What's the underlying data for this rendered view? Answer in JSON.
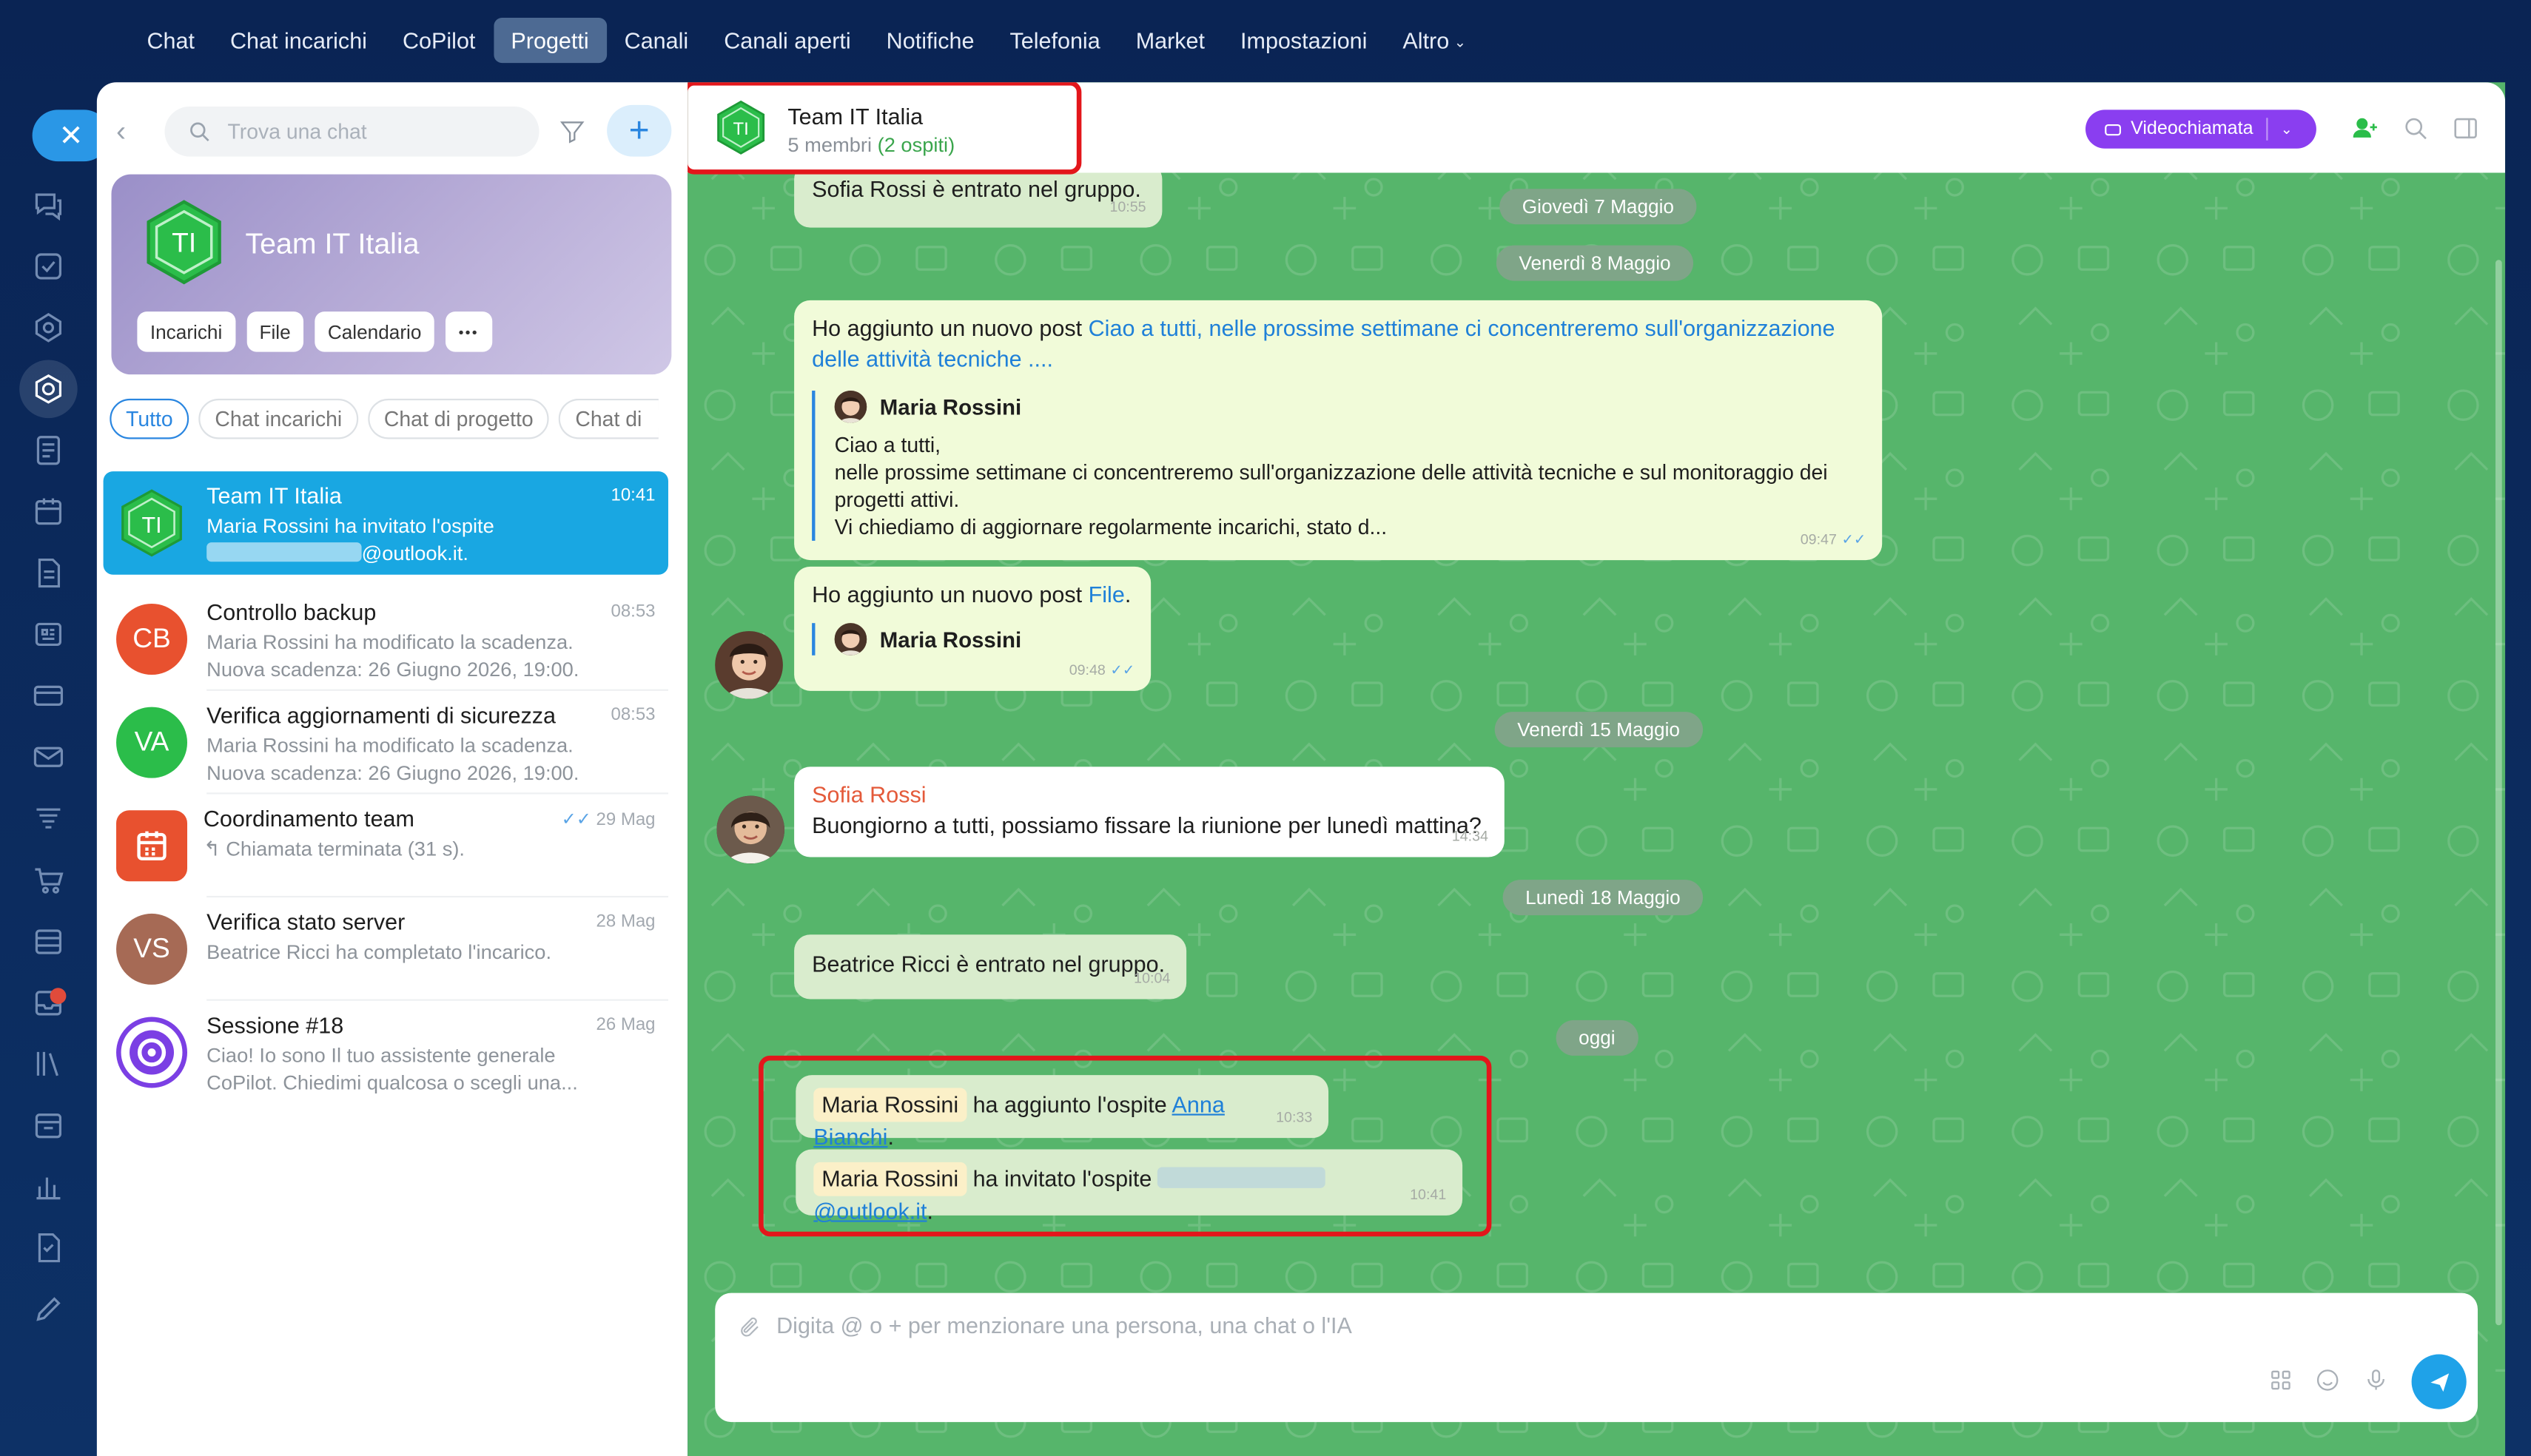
{
  "topnav": [
    {
      "label": "Chat",
      "active": false
    },
    {
      "label": "Chat incarichi",
      "active": false
    },
    {
      "label": "CoPilot",
      "active": false
    },
    {
      "label": "Progetti",
      "active": true
    },
    {
      "label": "Canali",
      "active": false
    },
    {
      "label": "Canali aperti",
      "active": false
    },
    {
      "label": "Notifiche",
      "active": false
    },
    {
      "label": "Telefonia",
      "active": false
    },
    {
      "label": "Market",
      "active": false
    },
    {
      "label": "Impostazioni",
      "active": false
    },
    {
      "label": "Altro",
      "active": false
    }
  ],
  "sidebar": {
    "search_placeholder": "Trova una chat",
    "card": {
      "initials": "TI",
      "name": "Team IT Italia",
      "chips": [
        "Incarichi",
        "File",
        "Calendario",
        "•••"
      ]
    },
    "filters": [
      "Tutto",
      "Chat incarichi",
      "Chat di progetto",
      "Chat di"
    ],
    "chats": [
      {
        "initials": "TI",
        "name": "Team IT Italia",
        "time": "10:41",
        "line1": "Maria Rossini ha invitato l'ospite",
        "line2": "@outlook.it.",
        "color": "#2bbd4a"
      },
      {
        "initials": "CB",
        "name": "Controllo backup",
        "time": "08:53",
        "line1": "Maria Rossini ha modificato la scadenza.",
        "line2": "Nuova scadenza: 26 Giugno 2026, 19:00.",
        "color": "#e8512f"
      },
      {
        "initials": "VA",
        "name": "Verifica aggiornamenti di sicurezza",
        "time": "08:53",
        "line1": "Maria Rossini ha modificato la scadenza.",
        "line2": "Nuova scadenza: 26 Giugno 2026, 19:00.",
        "color": "#2bbd4a"
      },
      {
        "initials": "",
        "name": "Coordinamento team",
        "time": "29 Mag",
        "line1": "↰ Chiamata terminata (31 s).",
        "line2": "",
        "color": "#e8512f"
      },
      {
        "initials": "VS",
        "name": "Verifica stato server",
        "time": "28 Mag",
        "line1": "Beatrice Ricci ha completato l'incarico.",
        "line2": "",
        "color": "#a66a55"
      },
      {
        "initials": "",
        "name": "Sessione #18",
        "time": "26 Mag",
        "line1": "Ciao! Io sono Il tuo assistente generale",
        "line2": "CoPilot. Chiedimi qualcosa o scegli una...",
        "color": "#7b3fe4"
      }
    ]
  },
  "chat": {
    "title": "Team IT Italia",
    "members": "5 membri",
    "guests": "(2 ospiti)",
    "video_label": "Videochiamata",
    "dates": [
      "Giovedì 7 Maggio",
      "Venerdì 8 Maggio",
      "Venerdì 15 Maggio",
      "Lunedì 18 Maggio",
      "oggi"
    ],
    "msg_sofia_join": {
      "text": "Sofia Rossi è entrato nel gruppo.",
      "time": "10:55"
    },
    "msg_post1": {
      "prefix": "Ho aggiunto un nuovo post ",
      "link": "Ciao a tutti, nelle prossime settimane ci concentreremo sull'organizzazione delle attività tecniche ....",
      "author": "Maria Rossini",
      "q1": "Ciao a tutti,",
      "q2": "nelle prossime settimane ci concentreremo sull'organizzazione delle attività tecniche e sul monitoraggio dei progetti attivi.",
      "q3": "Vi chiediamo di aggiornare regolarmente incarichi, stato d...",
      "time": "09:47"
    },
    "msg_post2": {
      "prefix": "Ho aggiunto un nuovo post ",
      "link": "File",
      "suffix": ".",
      "author": "Maria Rossini",
      "time": "09:48"
    },
    "msg_sofia": {
      "author": "Sofia Rossi",
      "text": "Buongiorno a tutti, possiamo fissare la riunione per lunedì mattina?",
      "time": "14:34"
    },
    "msg_beatrice_join": {
      "text": "Beatrice Ricci è entrato nel gruppo.",
      "time": "10:04"
    },
    "msg_guest1": {
      "who": "Maria Rossini",
      "text": " ha aggiunto l'ospite ",
      "link": "Anna Bianchi",
      "suffix": ".",
      "time": "10:33"
    },
    "msg_guest2": {
      "who": "Maria Rossini",
      "text": " ha invitato l'ospite ",
      "link": "@outlook.it",
      "suffix": ".",
      "time": "10:41"
    },
    "composer_placeholder": "Digita @ o + per menzionare una persona, una chat o l'IA"
  },
  "colors": {
    "accent": "#2a86e0",
    "chat_bg": "#56b56b",
    "highlight": "#e3161b",
    "video": "#8a3ef0"
  }
}
